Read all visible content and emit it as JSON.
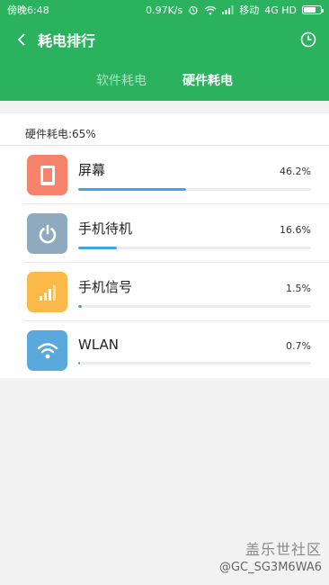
{
  "status_bar": {
    "time": "傍晚6:48",
    "speed": "0.97K/s",
    "carrier": "移动",
    "network": "4G HD",
    "battery_level": 0.7
  },
  "header": {
    "title": "耗电排行",
    "tabs": [
      {
        "label": "软件耗电",
        "active": false
      },
      {
        "label": "硬件耗电",
        "active": true
      }
    ]
  },
  "summary": "硬件耗电:65%",
  "items": [
    {
      "name": "屏幕",
      "percent_text": "46.2%",
      "percent": 46.2,
      "icon": "screen-icon",
      "color": "#f5826b"
    },
    {
      "name": "手机待机",
      "percent_text": "16.6%",
      "percent": 16.6,
      "icon": "power-icon",
      "color": "#8faabf"
    },
    {
      "name": "手机信号",
      "percent_text": "1.5%",
      "percent": 1.5,
      "icon": "signal-icon",
      "color": "#fbb94a"
    },
    {
      "name": "WLAN",
      "percent_text": "0.7%",
      "percent": 0.7,
      "icon": "wifi-icon",
      "color": "#5aa9dd"
    }
  ],
  "colors": {
    "accent": "#2ab25e",
    "bar_fill": "#3da7e8"
  },
  "watermark": {
    "line1": "盖乐世社区",
    "line2": "@GC_SG3M6WA6"
  }
}
